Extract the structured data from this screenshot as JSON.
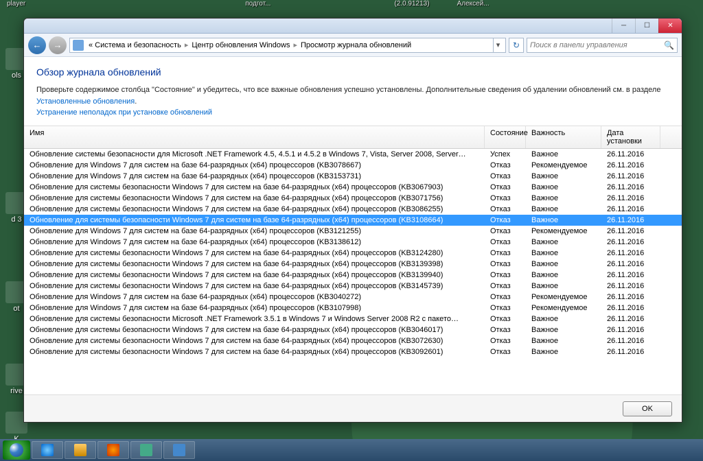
{
  "desktop": {
    "top_items": [
      "player",
      "подгот...",
      "(2.0.91213)",
      "Алексей..."
    ],
    "icons": [
      "ols",
      "d 3",
      "ot",
      "rive",
      "K"
    ]
  },
  "window": {
    "breadcrumb": {
      "root": "«",
      "items": [
        "Система и безопасность",
        "Центр обновления Windows",
        "Просмотр журнала обновлений"
      ]
    },
    "search_placeholder": "Поиск в панели управления",
    "heading": "Обзор журнала обновлений",
    "body_text": "Проверьте содержимое столбца \"Состояние\" и убедитесь, что все важные обновления успешно установлены. Дополнительные сведения об удалении обновлений см. в разделе ",
    "link1": "Установленные обновления",
    "link2": "Устранение неполадок при установке обновлений",
    "columns": {
      "name": "Имя",
      "status": "Состояние",
      "importance": "Важность",
      "date": "Дата установки"
    },
    "rows": [
      {
        "name": "Обновление системы безопасности для Microsoft .NET Framework 4.5, 4.5.1 и 4.5.2 в Windows 7, Vista, Server 2008, Server…",
        "status": "Успех",
        "importance": "Важное",
        "date": "26.11.2016",
        "sel": false
      },
      {
        "name": "Обновление для Windows 7 для систем на базе 64-разрядных (x64) процессоров (KB3078667)",
        "status": "Отказ",
        "importance": "Рекомендуемое",
        "date": "26.11.2016",
        "sel": false
      },
      {
        "name": "Обновление для Windows 7 для систем на базе 64-разрядных (x64) процессоров (KB3153731)",
        "status": "Отказ",
        "importance": "Важное",
        "date": "26.11.2016",
        "sel": false
      },
      {
        "name": "Обновление для системы безопасности Windows 7 для систем на базе 64-разрядных (x64) процессоров (KB3067903)",
        "status": "Отказ",
        "importance": "Важное",
        "date": "26.11.2016",
        "sel": false
      },
      {
        "name": "Обновление для системы безопасности Windows 7 для систем на базе 64-разрядных (x64) процессоров (KB3071756)",
        "status": "Отказ",
        "importance": "Важное",
        "date": "26.11.2016",
        "sel": false
      },
      {
        "name": "Обновление для системы безопасности Windows 7 для систем на базе 64-разрядных (x64) процессоров (KB3086255)",
        "status": "Отказ",
        "importance": "Важное",
        "date": "26.11.2016",
        "sel": false
      },
      {
        "name": "Обновление для системы безопасности Windows 7 для систем на базе 64-разрядных (x64) процессоров (KB3108664)",
        "status": "Отказ",
        "importance": "Важное",
        "date": "26.11.2016",
        "sel": true
      },
      {
        "name": "Обновление для Windows 7 для систем на базе 64-разрядных (x64) процессоров (KB3121255)",
        "status": "Отказ",
        "importance": "Рекомендуемое",
        "date": "26.11.2016",
        "sel": false
      },
      {
        "name": "Обновление для Windows 7 для систем на базе 64-разрядных (x64) процессоров (KB3138612)",
        "status": "Отказ",
        "importance": "Важное",
        "date": "26.11.2016",
        "sel": false
      },
      {
        "name": "Обновление для системы безопасности Windows 7 для систем на базе 64-разрядных (x64) процессоров (KB3124280)",
        "status": "Отказ",
        "importance": "Важное",
        "date": "26.11.2016",
        "sel": false
      },
      {
        "name": "Обновление для системы безопасности Windows 7 для систем на базе 64-разрядных (x64) процессоров (KB3139398)",
        "status": "Отказ",
        "importance": "Важное",
        "date": "26.11.2016",
        "sel": false
      },
      {
        "name": "Обновление для системы безопасности Windows 7 для систем на базе 64-разрядных (x64) процессоров (KB3139940)",
        "status": "Отказ",
        "importance": "Важное",
        "date": "26.11.2016",
        "sel": false
      },
      {
        "name": "Обновление для системы безопасности Windows 7 для систем на базе 64-разрядных (x64) процессоров (KB3145739)",
        "status": "Отказ",
        "importance": "Важное",
        "date": "26.11.2016",
        "sel": false
      },
      {
        "name": "Обновление для Windows 7 для систем на базе 64-разрядных (x64) процессоров (KB3040272)",
        "status": "Отказ",
        "importance": "Рекомендуемое",
        "date": "26.11.2016",
        "sel": false
      },
      {
        "name": "Обновление для Windows 7 для систем на базе 64-разрядных (x64) процессоров (KB3107998)",
        "status": "Отказ",
        "importance": "Рекомендуемое",
        "date": "26.11.2016",
        "sel": false
      },
      {
        "name": "Обновление для системы безопасности Microsoft .NET Framework 3.5.1 в Windows 7 и Windows Server 2008 R2 с пакето…",
        "status": "Отказ",
        "importance": "Важное",
        "date": "26.11.2016",
        "sel": false
      },
      {
        "name": "Обновление для системы безопасности Windows 7 для систем на базе 64-разрядных (x64) процессоров (KB3046017)",
        "status": "Отказ",
        "importance": "Важное",
        "date": "26.11.2016",
        "sel": false
      },
      {
        "name": "Обновление для системы безопасности Windows 7 для систем на базе 64-разрядных (x64) процессоров (KB3072630)",
        "status": "Отказ",
        "importance": "Важное",
        "date": "26.11.2016",
        "sel": false
      },
      {
        "name": "Обновление для системы безопасности Windows 7 для систем на базе 64-разрядных (x64) процессоров (KB3092601)",
        "status": "Отказ",
        "importance": "Важное",
        "date": "26.11.2016",
        "sel": false
      }
    ],
    "ok_label": "OK"
  }
}
